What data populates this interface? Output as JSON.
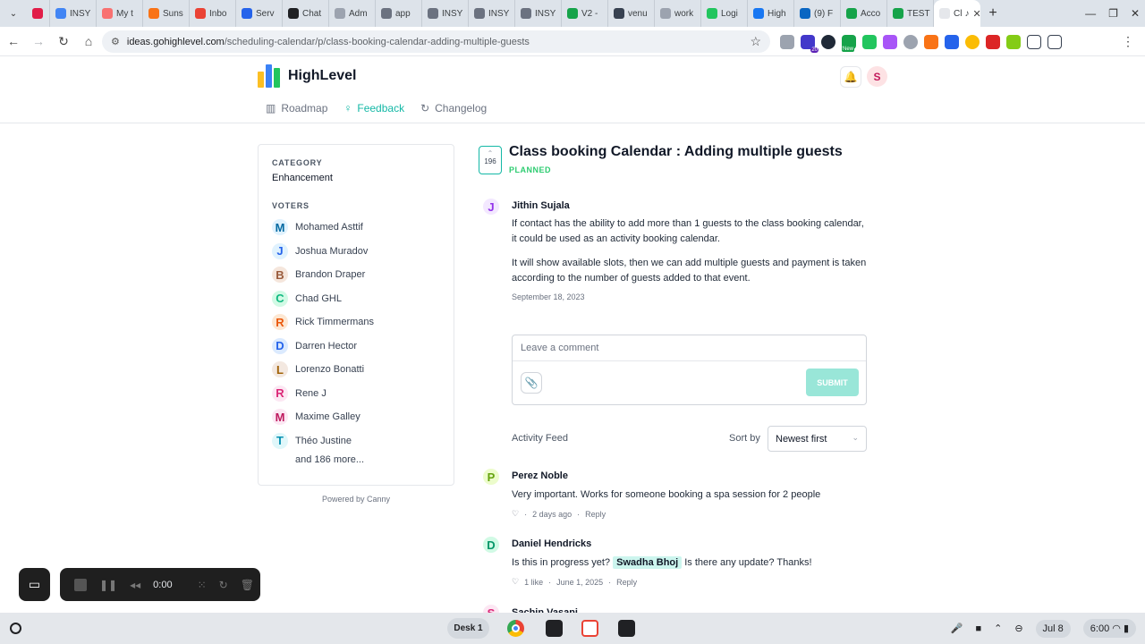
{
  "browser": {
    "tabs": [
      {
        "label": "",
        "color": "#e11d48"
      },
      {
        "label": "INSY",
        "color": "#4285f4"
      },
      {
        "label": "My t",
        "color": "#f87171"
      },
      {
        "label": "Suns",
        "color": "#f97316"
      },
      {
        "label": "Inbo",
        "color": "#ea4335"
      },
      {
        "label": "Serv",
        "color": "#2563eb"
      },
      {
        "label": "Chat",
        "color": "#202124"
      },
      {
        "label": "Adm",
        "color": "#9ca3af"
      },
      {
        "label": "app",
        "color": "#6b7280"
      },
      {
        "label": "INSY",
        "color": "#6b7280"
      },
      {
        "label": "INSY",
        "color": "#6b7280"
      },
      {
        "label": "INSY",
        "color": "#6b7280"
      },
      {
        "label": "V2 -",
        "color": "#16a34a"
      },
      {
        "label": "venu",
        "color": "#374151"
      },
      {
        "label": "work",
        "color": "#9ca3af"
      },
      {
        "label": "Logi",
        "color": "#22c55e"
      },
      {
        "label": "High",
        "color": "#1877f2"
      },
      {
        "label": "(9) F",
        "color": "#0a66c2"
      },
      {
        "label": "Acco",
        "color": "#16a34a"
      },
      {
        "label": "TEST",
        "color": "#16a34a"
      }
    ],
    "active_tab": {
      "label": "Cl"
    },
    "url_host": "ideas.gohighlevel.com",
    "url_path": "/scheduling-calendar/p/class-booking-calendar-adding-multiple-guests",
    "extension_badges": [
      "20",
      "New"
    ]
  },
  "site": {
    "brand": "HighLevel",
    "user_initial": "S",
    "nav": [
      {
        "label": "Roadmap",
        "icon": "map-icon",
        "active": false
      },
      {
        "label": "Feedback",
        "icon": "bulb-icon",
        "active": true
      },
      {
        "label": "Changelog",
        "icon": "refresh-icon",
        "active": false
      }
    ]
  },
  "sidebar": {
    "category_label": "CATEGORY",
    "category_value": "Enhancement",
    "voters_label": "VOTERS",
    "voters": [
      {
        "initial": "M",
        "name": "Mohamed Asttif",
        "bg": "#e0f2fe",
        "fg": "#0369a1"
      },
      {
        "initial": "J",
        "name": "Joshua Muradov",
        "bg": "#e0f2fe",
        "fg": "#2563eb"
      },
      {
        "initial": "B",
        "name": "Brandon Draper",
        "bg": "#f5e6dc",
        "fg": "#9a5b3c"
      },
      {
        "initial": "C",
        "name": "Chad GHL",
        "bg": "#d1fae5",
        "fg": "#10b981"
      },
      {
        "initial": "R",
        "name": "Rick Timmermans",
        "bg": "#fde7d2",
        "fg": "#ea580c"
      },
      {
        "initial": "D",
        "name": "Darren Hector",
        "bg": "#dbeafe",
        "fg": "#2563eb"
      },
      {
        "initial": "L",
        "name": "Lorenzo Bonatti",
        "bg": "#f3e8e0",
        "fg": "#a16207"
      },
      {
        "initial": "R",
        "name": "Rene J",
        "bg": "#fce7f3",
        "fg": "#db2777"
      },
      {
        "initial": "M",
        "name": "Maxime Galley",
        "bg": "#fce7f3",
        "fg": "#be185d"
      },
      {
        "initial": "T",
        "name": "Théo Justine",
        "bg": "#e0f7fa",
        "fg": "#0891b2"
      }
    ],
    "more": "and 186 more...",
    "powered_by": "Powered by Canny"
  },
  "post": {
    "votes": "196",
    "title": "Class booking Calendar : Adding multiple guests",
    "status": "PLANNED",
    "author_initial": "J",
    "author": "Jithin Sujala",
    "paragraphs": [
      "If contact has the ability to add more than 1 guests to the class booking calendar, it could be used as an activity booking calendar.",
      "It will show available slots, then we can add multiple guests and payment is taken according to the number of guests added to that event."
    ],
    "date": "September 18, 2023"
  },
  "composer": {
    "placeholder": "Leave a comment",
    "submit": "SUBMIT"
  },
  "feed": {
    "title": "Activity Feed",
    "sort_label": "Sort by",
    "sort_value": "Newest first",
    "comments": [
      {
        "initial": "P",
        "name": "Perez Noble",
        "text": "Very important. Works for someone booking a spa session for 2 people",
        "likes": "",
        "time": "2 days ago",
        "reply": "Reply",
        "bg": "#ecfccb",
        "fg": "#65a30d"
      },
      {
        "initial": "D",
        "name": "Daniel Hendricks",
        "text_before": "Is this in progress yet?",
        "mention": "Swadha Bhoj",
        "text_after": "Is there any update? Thanks!",
        "likes": "1 like",
        "time": "June 1, 2025",
        "reply": "Reply",
        "bg": "#d1fae5",
        "fg": "#059669"
      },
      {
        "initial": "S",
        "name": "Sachin Vasani",
        "bg": "#fce7f3",
        "fg": "#db2777"
      }
    ]
  },
  "recorder": {
    "time": "0:00"
  },
  "shelf": {
    "desk": "Desk 1",
    "date": "Jul 8",
    "time": "6:00"
  }
}
